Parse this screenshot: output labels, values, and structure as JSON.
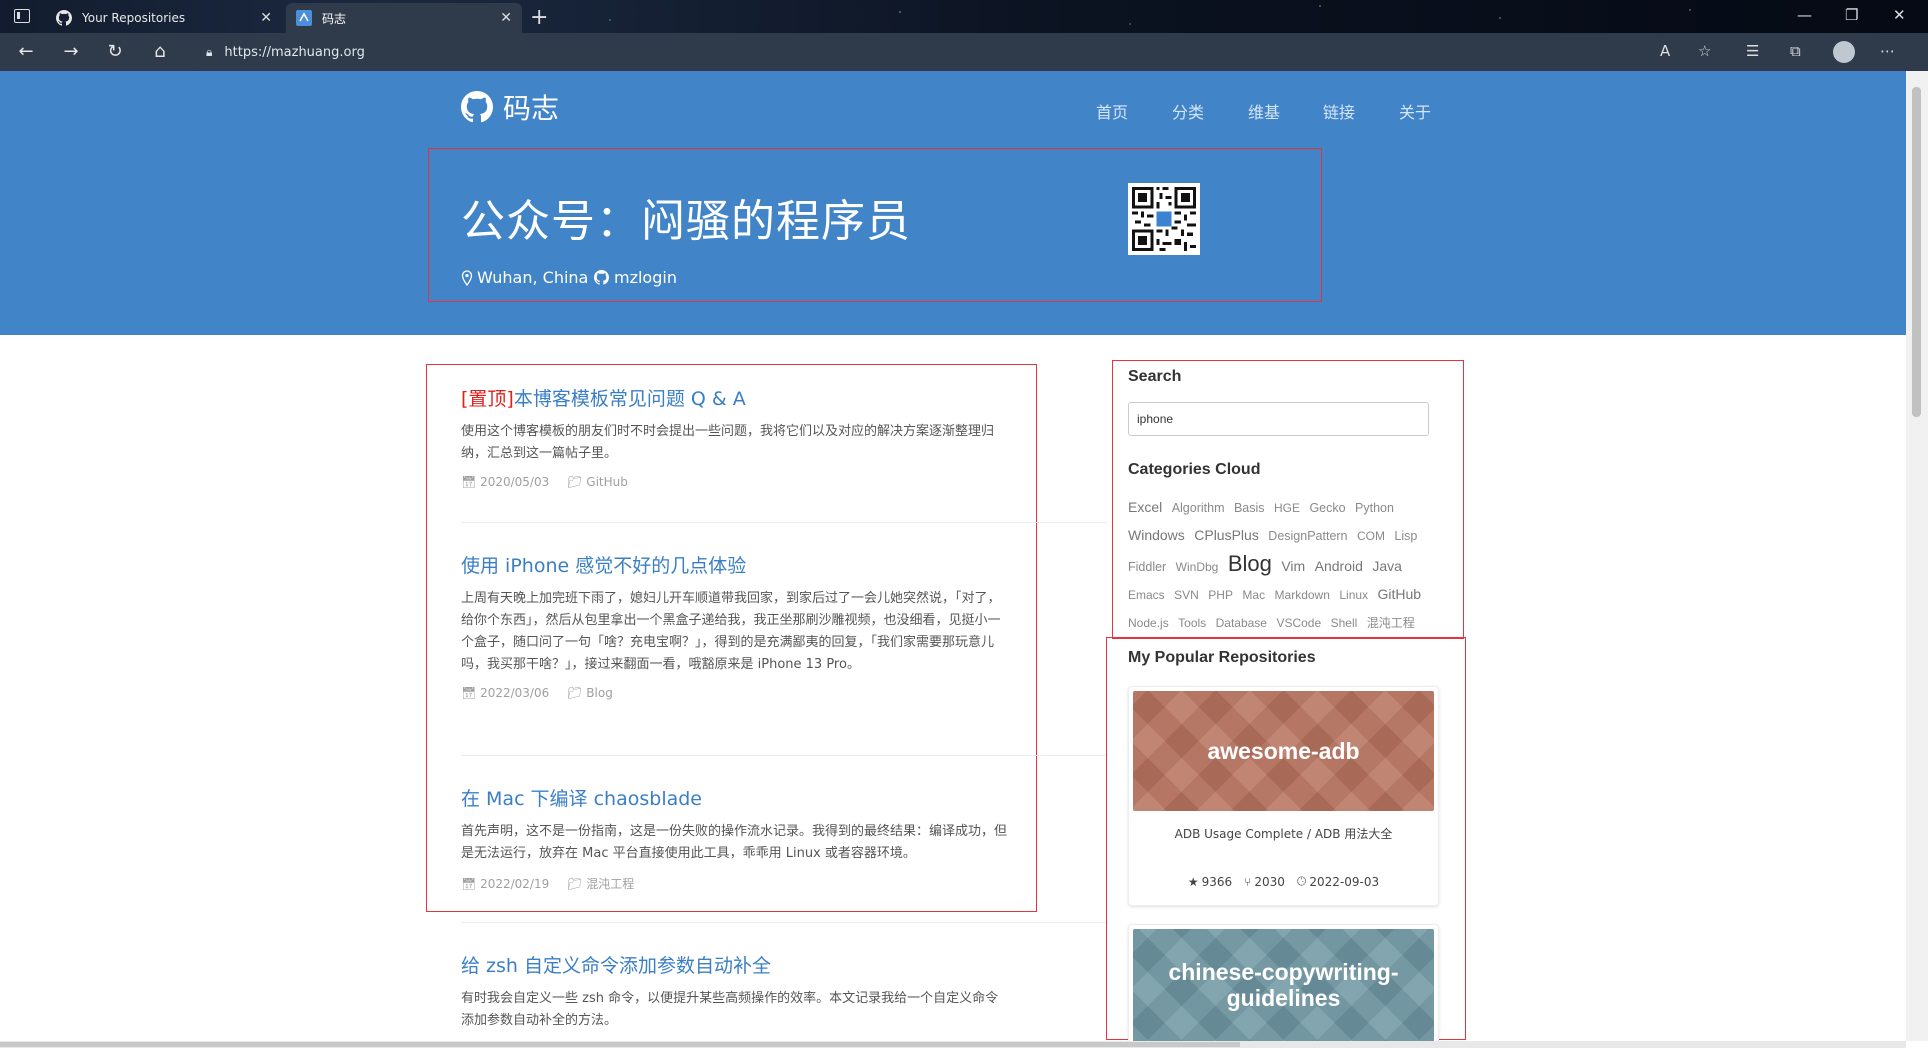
{
  "browser": {
    "tabs": [
      {
        "title": "Your Repositories",
        "active": false
      },
      {
        "title": "码志",
        "active": true
      }
    ],
    "url": "https://mazhuang.org"
  },
  "site": {
    "logo_text": "码志",
    "nav": [
      "首页",
      "分类",
      "维基",
      "链接",
      "关于"
    ],
    "banner_title": "公众号：闷骚的程序员",
    "location": "Wuhan, China",
    "github_user": "mzlogin"
  },
  "posts": [
    {
      "pin": "[置顶]",
      "title": "本博客模板常见问题 Q & A",
      "excerpt": "使用这个博客模板的朋友们时不时会提出一些问题，我将它们以及对应的解决方案逐渐整理归纳，汇总到这一篇帖子里。",
      "date": "2020/05/03",
      "category": "GitHub"
    },
    {
      "pin": "",
      "title": "使用 iPhone 感觉不好的几点体验",
      "excerpt": "上周有天晚上加完班下雨了，媳妇儿开车顺道带我回家，到家后过了一会儿她突然说，「对了，给你个东西」，然后从包里拿出一个黑盒子递给我，我正坐那刷沙雕视频，也没细看，见挺小一个盒子，随口问了一句「啥？充电宝啊？」，得到的是充满鄙夷的回复，「我们家需要那玩意儿吗，我买那干啥？」，接过来翻面一看，哦豁原来是 iPhone 13 Pro。",
      "date": "2022/03/06",
      "category": "Blog"
    },
    {
      "pin": "",
      "title": "在 Mac 下编译 chaosblade",
      "excerpt": "首先声明，这不是一份指南，这是一份失败的操作流水记录。我得到的最终结果：编译成功，但是无法运行，放弃在 Mac 平台直接使用此工具，乖乖用 Linux 或者容器环境。",
      "date": "2022/02/19",
      "category": "混沌工程"
    },
    {
      "pin": "",
      "title": "给 zsh 自定义命令添加参数自动补全",
      "excerpt": "有时我会自定义一些 zsh 命令，以便提升某些高频操作的效率。本文记录我给一个自定义命令添加参数自动补全的方法。",
      "date": "",
      "category": ""
    }
  ],
  "sidebar": {
    "search_heading": "Search",
    "search_value": "iphone",
    "categories_heading": "Categories Cloud",
    "categories": [
      {
        "name": "Excel",
        "size": "m"
      },
      {
        "name": "Algorithm",
        "size": "s"
      },
      {
        "name": "Basis",
        "size": "s"
      },
      {
        "name": "HGE",
        "size": "xs"
      },
      {
        "name": "Gecko",
        "size": "s"
      },
      {
        "name": "Python",
        "size": "s"
      },
      {
        "name": "Windows",
        "size": "m"
      },
      {
        "name": "CPlusPlus",
        "size": "m"
      },
      {
        "name": "DesignPattern",
        "size": "s"
      },
      {
        "name": "COM",
        "size": "xs"
      },
      {
        "name": "Lisp",
        "size": "s"
      },
      {
        "name": "Fiddler",
        "size": "s"
      },
      {
        "name": "WinDbg",
        "size": "xs"
      },
      {
        "name": "Blog",
        "size": "xl"
      },
      {
        "name": "Vim",
        "size": "m"
      },
      {
        "name": "Android",
        "size": "m"
      },
      {
        "name": "Java",
        "size": "m"
      },
      {
        "name": "Emacs",
        "size": "xs"
      },
      {
        "name": "SVN",
        "size": "xs"
      },
      {
        "name": "PHP",
        "size": "xs"
      },
      {
        "name": "Mac",
        "size": "xs"
      },
      {
        "name": "Markdown",
        "size": "xs"
      },
      {
        "name": "Linux",
        "size": "xs"
      },
      {
        "name": "GitHub",
        "size": "m"
      },
      {
        "name": "Node.js",
        "size": "xs"
      },
      {
        "name": "Tools",
        "size": "xs"
      },
      {
        "name": "Database",
        "size": "xs"
      },
      {
        "name": "VSCode",
        "size": "xs"
      },
      {
        "name": "Shell",
        "size": "xs"
      },
      {
        "name": "混沌工程",
        "size": "xs"
      }
    ],
    "repos_heading": "My Popular Repositories",
    "repos": [
      {
        "name": "awesome-adb",
        "desc": "ADB Usage Complete / ADB 用法大全",
        "stars": "9366",
        "forks": "2030",
        "updated": "2022-09-03",
        "color": "#b8735f"
      },
      {
        "name": "chinese-copywriting-guidelines",
        "desc": "",
        "stars": "",
        "forks": "",
        "updated": "",
        "color": "#6f97a3"
      }
    ]
  },
  "colors": {
    "banner": "#4184c8",
    "link": "#3a7fc5",
    "pin": "#e0201b",
    "annotation": "#e5343d"
  }
}
